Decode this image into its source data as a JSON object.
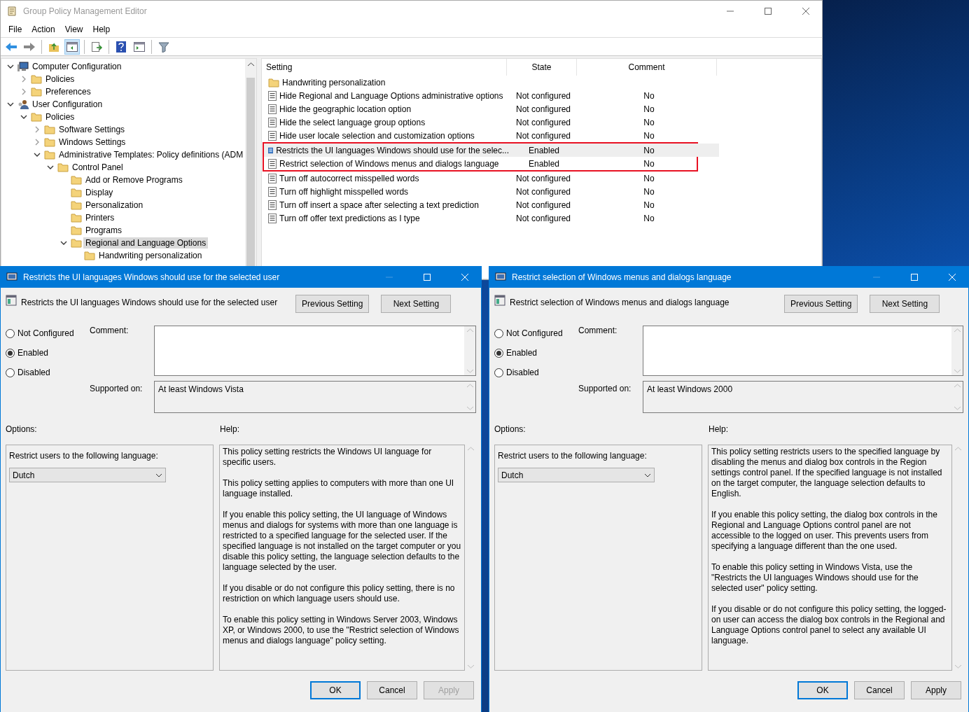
{
  "window": {
    "title": "Group Policy Management Editor"
  },
  "menu": [
    "File",
    "Action",
    "View",
    "Help"
  ],
  "tree": [
    {
      "label": "Computer Configuration",
      "kind": "computer",
      "expanded": true,
      "selected": false,
      "children": [
        {
          "label": "Policies",
          "kind": "folder",
          "expanded": false,
          "selected": false
        },
        {
          "label": "Preferences",
          "kind": "folder",
          "expanded": false,
          "selected": false
        }
      ]
    },
    {
      "label": "User Configuration",
      "kind": "user",
      "expanded": true,
      "selected": false,
      "children": [
        {
          "label": "Policies",
          "kind": "folder",
          "expanded": true,
          "selected": false,
          "children": [
            {
              "label": "Software Settings",
              "kind": "folder",
              "expanded": false,
              "selected": false
            },
            {
              "label": "Windows Settings",
              "kind": "folder",
              "expanded": false,
              "selected": false
            },
            {
              "label": "Administrative Templates: Policy definitions (ADM",
              "kind": "folder",
              "expanded": true,
              "selected": false,
              "children": [
                {
                  "label": "Control Panel",
                  "kind": "folder",
                  "expanded": true,
                  "selected": false,
                  "children": [
                    {
                      "label": "Add or Remove Programs",
                      "kind": "folder",
                      "selected": false
                    },
                    {
                      "label": "Display",
                      "kind": "folder",
                      "selected": false
                    },
                    {
                      "label": "Personalization",
                      "kind": "folder",
                      "selected": false
                    },
                    {
                      "label": "Printers",
                      "kind": "folder",
                      "selected": false
                    },
                    {
                      "label": "Programs",
                      "kind": "folder",
                      "selected": false
                    },
                    {
                      "label": "Regional and Language Options",
                      "kind": "folder",
                      "expanded": true,
                      "selected": true,
                      "children": [
                        {
                          "label": "Handwriting personalization",
                          "kind": "folder",
                          "selected": false
                        }
                      ]
                    }
                  ]
                }
              ]
            }
          ]
        }
      ]
    }
  ],
  "table": {
    "columns": [
      "Setting",
      "State",
      "Comment"
    ],
    "rows": [
      {
        "kind": "folder",
        "setting": "Handwriting personalization",
        "selected": false,
        "marked": false
      },
      {
        "kind": "policy",
        "setting": "Hide Regional and Language Options administrative options",
        "state": "Not configured",
        "comment": "No",
        "selected": false,
        "marked": false
      },
      {
        "kind": "policy",
        "setting": "Hide the geographic location option",
        "state": "Not configured",
        "comment": "No",
        "selected": false,
        "marked": false
      },
      {
        "kind": "policy",
        "setting": "Hide the select language group options",
        "state": "Not configured",
        "comment": "No",
        "selected": false,
        "marked": false
      },
      {
        "kind": "policy",
        "setting": "Hide user locale selection and customization options",
        "state": "Not configured",
        "comment": "No",
        "selected": false,
        "marked": false
      },
      {
        "kind": "policy",
        "setting": "Restricts the UI languages Windows should use for the selec...",
        "state": "Enabled",
        "comment": "No",
        "selected": true,
        "marked": true
      },
      {
        "kind": "policy",
        "setting": "Restrict selection of Windows menus and dialogs language",
        "state": "Enabled",
        "comment": "No",
        "selected": false,
        "marked": true
      },
      {
        "kind": "policy",
        "setting": "Turn off autocorrect misspelled words",
        "state": "Not configured",
        "comment": "No",
        "selected": false,
        "marked": false
      },
      {
        "kind": "policy",
        "setting": "Turn off highlight misspelled words",
        "state": "Not configured",
        "comment": "No",
        "selected": false,
        "marked": false
      },
      {
        "kind": "policy",
        "setting": "Turn off insert a space after selecting a text prediction",
        "state": "Not configured",
        "comment": "No",
        "selected": false,
        "marked": false
      },
      {
        "kind": "policy",
        "setting": "Turn off offer text predictions as I type",
        "state": "Not configured",
        "comment": "No",
        "selected": false,
        "marked": false
      }
    ]
  },
  "dialogs": [
    {
      "title": "Restricts the UI languages Windows should use for the selected user",
      "heading": "Restricts the UI languages Windows should use for the selected user",
      "minimize_disabled": true,
      "nav_buttons": [
        "Previous Setting",
        "Next Setting"
      ],
      "radios": [
        {
          "label": "Not Configured",
          "selected": false
        },
        {
          "label": "Enabled",
          "selected": true
        },
        {
          "label": "Disabled",
          "selected": false
        }
      ],
      "comment_label": "Comment:",
      "supported_label": "Supported on:",
      "supported_on": "At least Windows Vista",
      "options_label": "Options:",
      "help_label": "Help:",
      "option_text": "Restrict users to the following language:",
      "dropdown_value": "Dutch",
      "help": [
        "This policy setting restricts the Windows UI language for specific users.",
        "This policy setting applies to computers with more than one UI language installed.",
        "If you enable this policy setting, the UI language of Windows menus and dialogs for systems with more than one language is restricted to a specified language for the selected user. If the specified language is not installed on the target computer or you disable this policy setting, the language selection defaults to the language selected by the user.",
        "If you disable or do not configure this policy setting, there is no restriction on which language users should use.",
        "To enable this policy setting in Windows Server 2003, Windows XP, or Windows 2000, to use the \"Restrict selection of Windows menus and dialogs language\" policy setting."
      ],
      "footer_buttons": [
        {
          "label": "OK",
          "disabled": false,
          "default": true
        },
        {
          "label": "Cancel",
          "disabled": false,
          "default": false
        },
        {
          "label": "Apply",
          "disabled": true,
          "default": false
        }
      ]
    },
    {
      "title": "Restrict selection of Windows menus and dialogs language",
      "heading": "Restrict selection of Windows menus and dialogs language",
      "minimize_disabled": true,
      "nav_buttons": [
        "Previous Setting",
        "Next Setting"
      ],
      "radios": [
        {
          "label": "Not Configured",
          "selected": false
        },
        {
          "label": "Enabled",
          "selected": true
        },
        {
          "label": "Disabled",
          "selected": false
        }
      ],
      "comment_label": "Comment:",
      "supported_label": "Supported on:",
      "supported_on": "At least Windows 2000",
      "options_label": "Options:",
      "help_label": "Help:",
      "option_text": "Restrict users to the following language:",
      "dropdown_value": "Dutch",
      "help": [
        "This policy setting restricts users to the specified language by disabling the menus and dialog box controls in the Region settings control panel. If the specified language is not installed on the target computer, the language selection defaults to English.",
        "If you enable this policy setting, the dialog box controls in the Regional and Language Options control panel are not accessible to the logged on user. This prevents users from specifying a language different than the one used.",
        "To enable this policy setting in Windows Vista, use the \"Restricts the UI languages Windows should use for the selected user\" policy setting.",
        "If you disable or do not configure this policy setting, the logged-on user can access the dialog box controls in the Regional and Language Options control panel to select any available UI language."
      ],
      "footer_buttons": [
        {
          "label": "OK",
          "disabled": false,
          "default": true
        },
        {
          "label": "Cancel",
          "disabled": false,
          "default": false
        },
        {
          "label": "Apply",
          "disabled": false,
          "default": false
        }
      ]
    }
  ]
}
